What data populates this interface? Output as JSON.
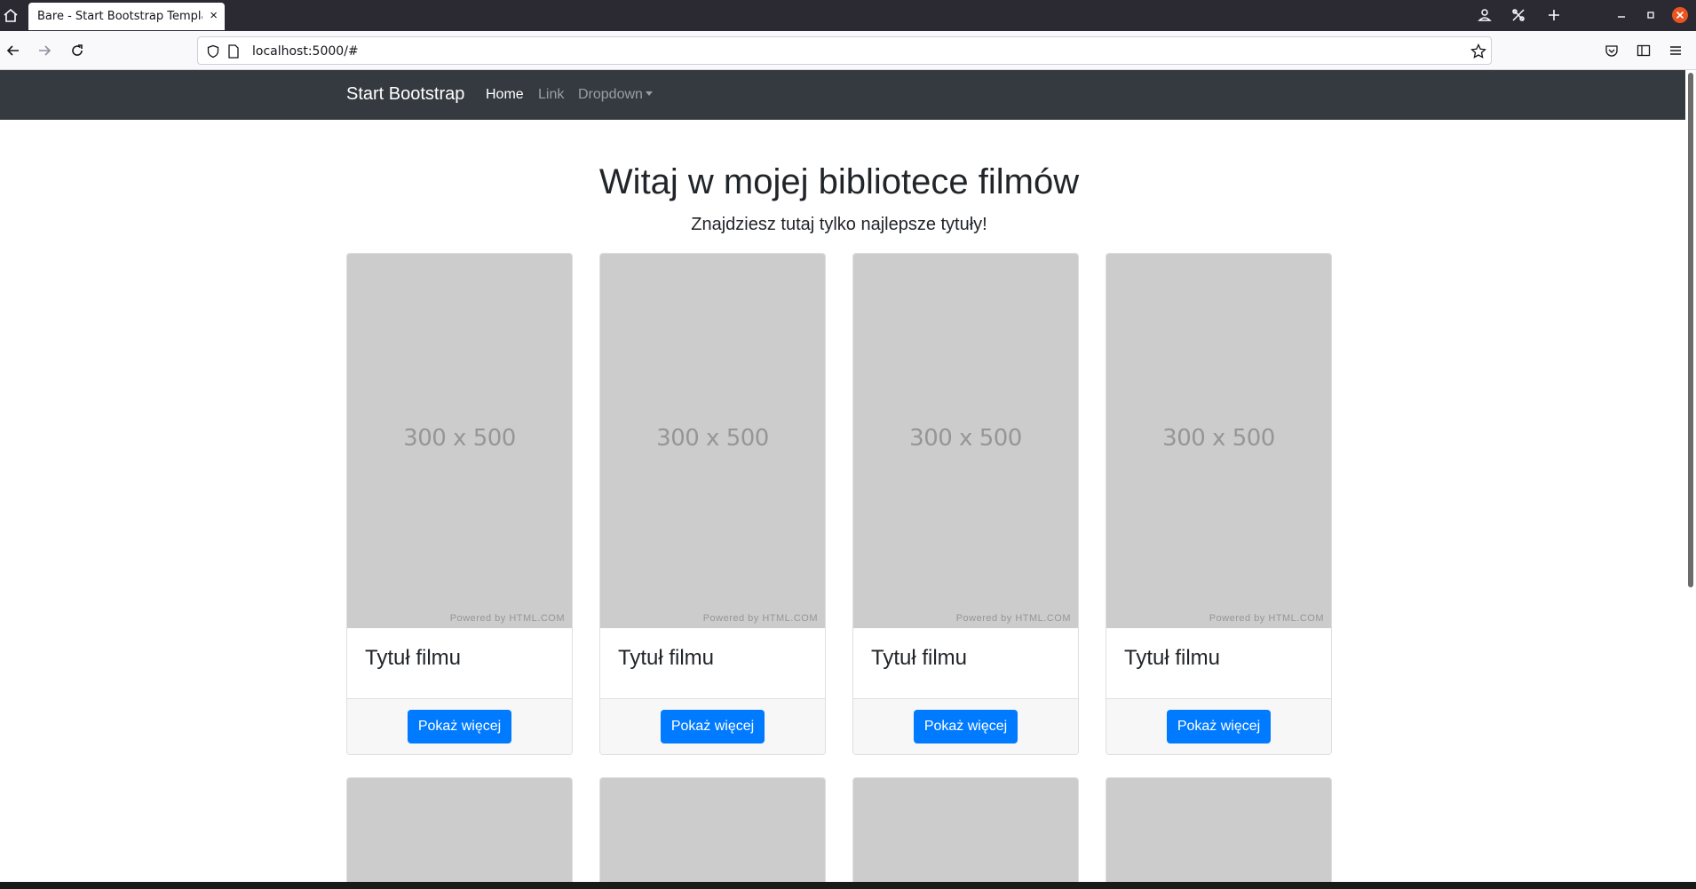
{
  "browser": {
    "tab_title": "Bare - Start Bootstrap Template",
    "tab_close": "×",
    "url": "localhost:5000/#"
  },
  "site": {
    "brand": "Start Bootstrap",
    "nav": {
      "home": "Home",
      "link": "Link",
      "dropdown": "Dropdown"
    },
    "hero": {
      "title": "Witaj w mojej bibliotece filmów",
      "subtitle": "Znajdziesz tutaj tylko najlepsze tytuły!"
    },
    "cards": [
      {
        "placeholder": "300 x 500",
        "powered": "Powered by HTML.COM",
        "title": "Tytuł filmu",
        "button": "Pokaż więcej"
      },
      {
        "placeholder": "300 x 500",
        "powered": "Powered by HTML.COM",
        "title": "Tytuł filmu",
        "button": "Pokaż więcej"
      },
      {
        "placeholder": "300 x 500",
        "powered": "Powered by HTML.COM",
        "title": "Tytuł filmu",
        "button": "Pokaż więcej"
      },
      {
        "placeholder": "300 x 500",
        "powered": "Powered by HTML.COM",
        "title": "Tytuł filmu",
        "button": "Pokaż więcej"
      }
    ],
    "colors": {
      "navbar": "#343a40",
      "primary_button": "#007bff",
      "placeholder_bg": "#cccccc"
    }
  }
}
